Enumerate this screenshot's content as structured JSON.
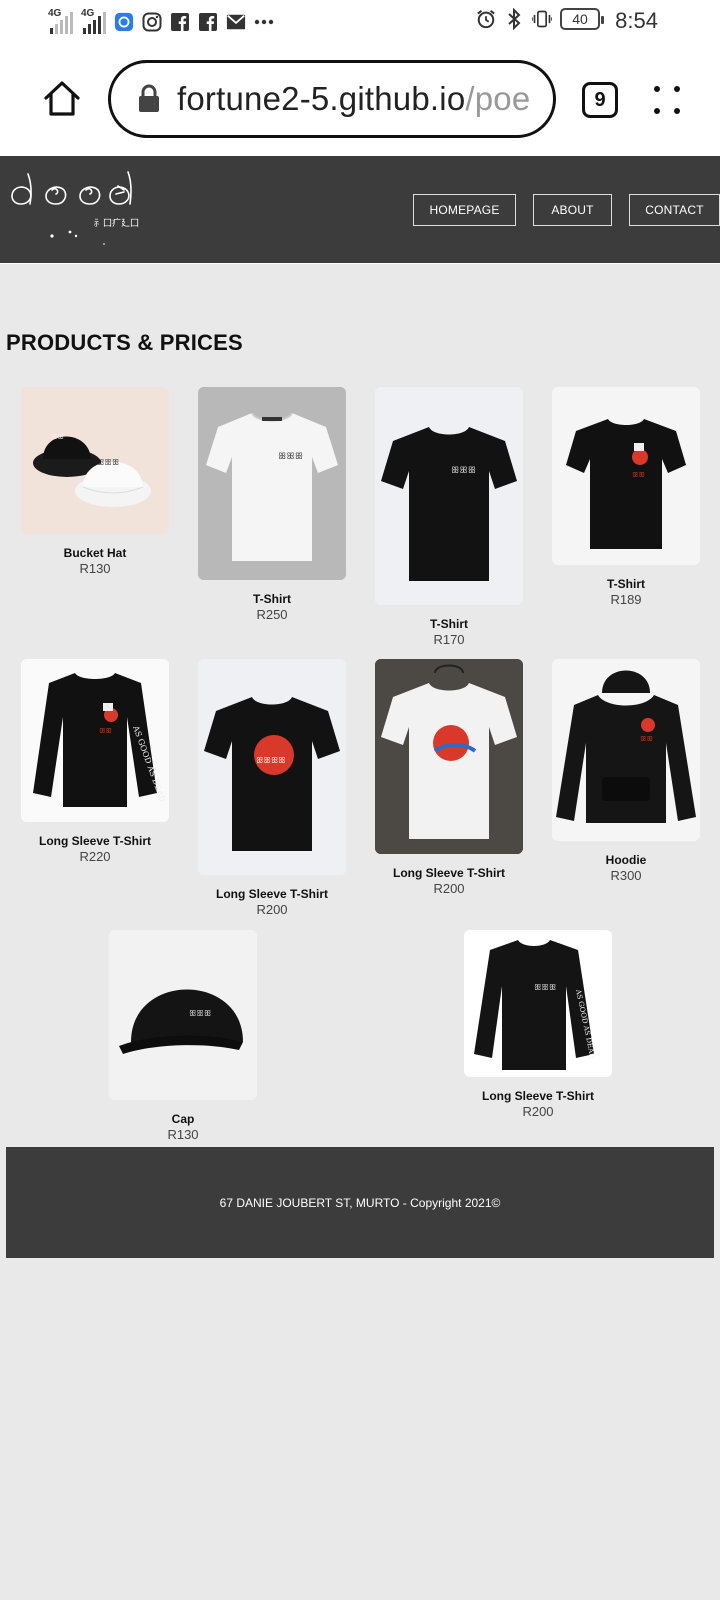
{
  "status_bar": {
    "net1": "4G",
    "net2": "4G",
    "battery": "40",
    "time": "8:54",
    "icons": [
      "signal-icon",
      "signal-icon",
      "app-icon",
      "instagram-icon",
      "facebook-icon",
      "facebook-icon",
      "mail-icon",
      "more-icon",
      "alarm-icon",
      "bluetooth-icon",
      "vibrate-icon",
      "battery-icon"
    ]
  },
  "browser": {
    "url_main": "fortune2-5.github.io",
    "url_path": "/poe",
    "tab_count": "9"
  },
  "header": {
    "nav": [
      "HOMEPAGE",
      "ABOUT",
      "CONTACT"
    ]
  },
  "main": {
    "heading": "PRODUCTS & PRICES",
    "products": [
      {
        "name": "Bucket Hat",
        "price": "R130"
      },
      {
        "name": "T-Shirt",
        "price": "R250"
      },
      {
        "name": "T-Shirt",
        "price": "R170"
      },
      {
        "name": "T-Shirt",
        "price": "R189"
      },
      {
        "name": "Long Sleeve T-Shirt",
        "price": "R220"
      },
      {
        "name": "Long Sleeve T-Shirt",
        "price": "R200"
      },
      {
        "name": "Long Sleeve T-Shirt",
        "price": "R200"
      },
      {
        "name": "Hoodie",
        "price": "R300"
      },
      {
        "name": "Cap",
        "price": "R130"
      },
      {
        "name": "Long Sleeve T-Shirt",
        "price": "R200"
      }
    ]
  },
  "footer": {
    "text": "67 DANIE JOUBERT ST, MURTO - Copyright 2021©"
  },
  "colors": {
    "header_bg": "#3c3c3c",
    "page_bg": "#e9e9ea",
    "accent_red": "#d9392b"
  }
}
